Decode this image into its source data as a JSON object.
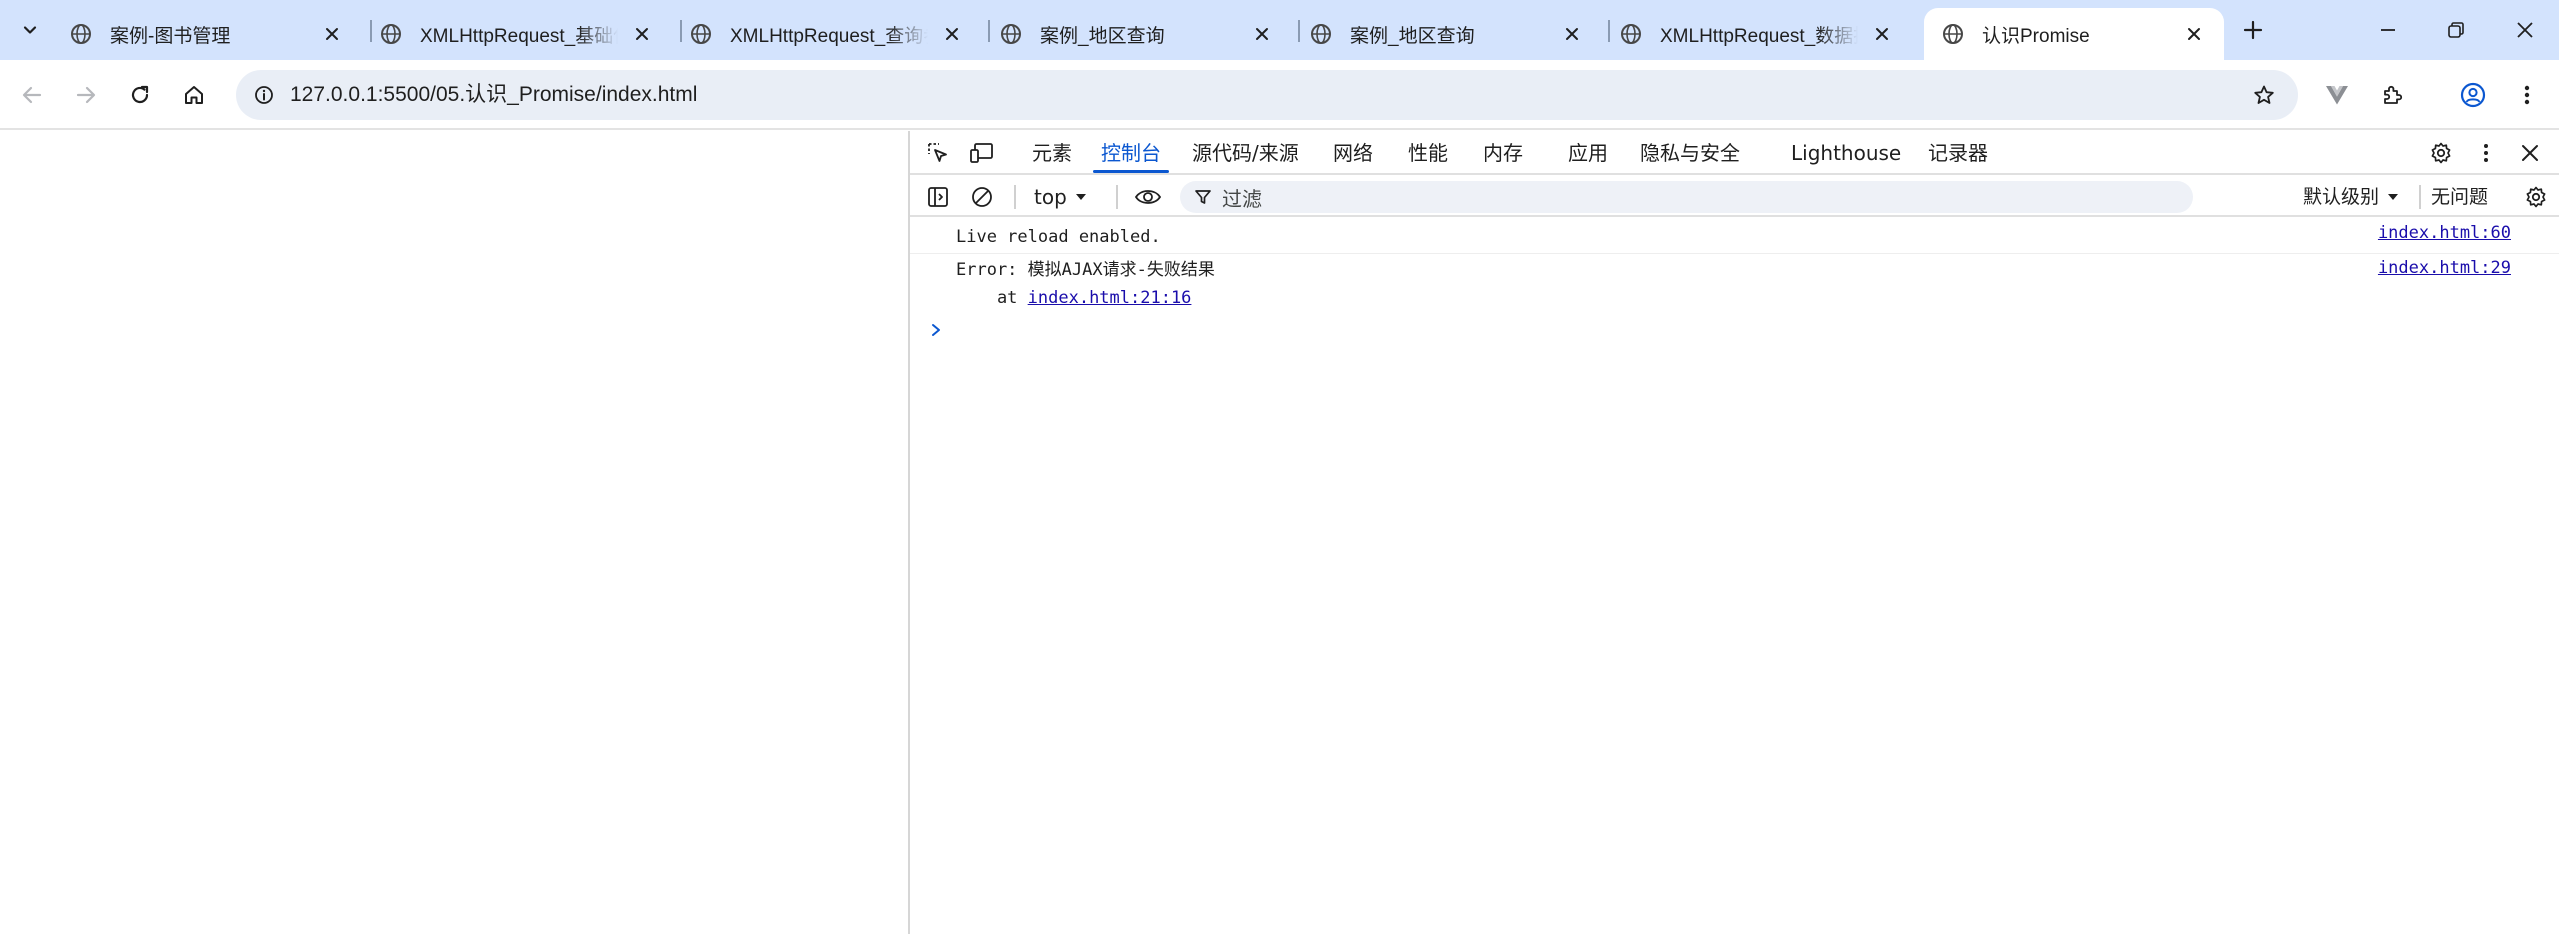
{
  "browser": {
    "tabs": [
      {
        "title": "案例-图书管理",
        "active": false
      },
      {
        "title": "XMLHttpRequest_基础使用",
        "active": false
      },
      {
        "title": "XMLHttpRequest_查询参数",
        "active": false
      },
      {
        "title": "案例_地区查询",
        "active": false
      },
      {
        "title": "案例_地区查询",
        "active": false
      },
      {
        "title": "XMLHttpRequest_数据提交",
        "active": false
      },
      {
        "title": "认识Promise",
        "active": true
      }
    ],
    "url": "127.0.0.1:5500/05.认识_Promise/index.html"
  },
  "devtools": {
    "tabs": [
      "元素",
      "控制台",
      "源代码/来源",
      "网络",
      "性能",
      "内存",
      "应用",
      "隐私与安全",
      "Lighthouse",
      "记录器"
    ],
    "active_tab": "控制台",
    "context": "top",
    "filter_placeholder": "过滤",
    "levels": "默认级别",
    "issues": "无问题"
  },
  "console": {
    "messages": [
      {
        "text": "Live reload enabled.",
        "source": "index.html:60"
      },
      {
        "text": "Error: 模拟AJAX请求-失败结果",
        "stack_prefix": "    at ",
        "stack_link": "index.html:21:16",
        "source": "index.html:29"
      }
    ]
  },
  "colors": {
    "tabstrip_bg": "#d3e3fd",
    "omnibox_bg": "#e9eef6",
    "accent": "#0b57d0",
    "link": "#1a0dab"
  }
}
